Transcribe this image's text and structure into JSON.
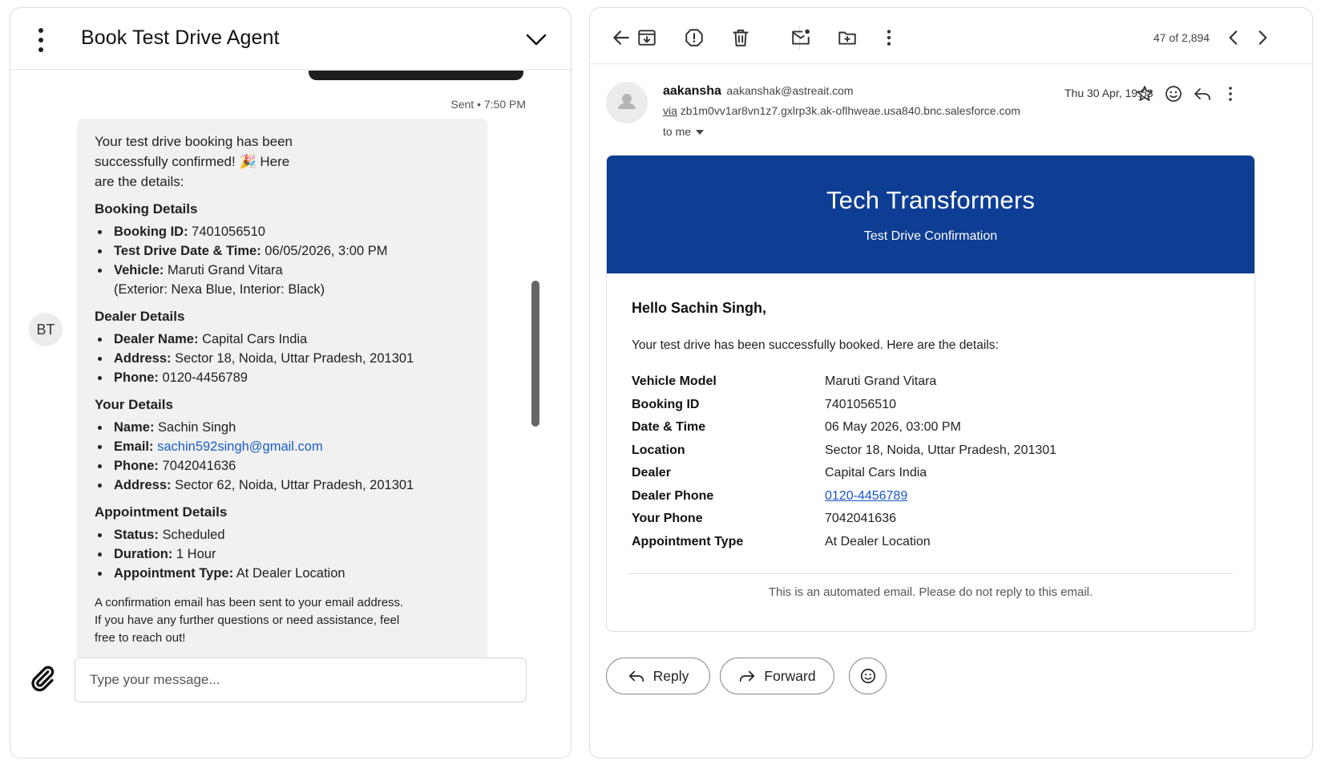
{
  "chat": {
    "title": "Book Test Drive Agent",
    "sent_meta": "Sent • 7:50 PM",
    "avatar_initials": "BT",
    "intro_line1": "Your test drive booking has been",
    "intro_line2": "successfully confirmed! 🎉 Here",
    "intro_line3": "are the details:",
    "booking": {
      "heading": "Booking Details",
      "id_label": "Booking ID:",
      "id_value": "7401056510",
      "date_label": "Test Drive Date & Time:",
      "date_value": "06/05/2026, 3:00 PM",
      "vehicle_label": "Vehicle:",
      "vehicle_value": "Maruti Grand Vitara",
      "vehicle_colors": "(Exterior: Nexa Blue, Interior: Black)"
    },
    "dealer": {
      "heading": "Dealer Details",
      "name_label": "Dealer Name:",
      "name_value": "Capital Cars India",
      "address_label": "Address:",
      "address_value": "Sector 18, Noida, Uttar Pradesh, 201301",
      "phone_label": "Phone:",
      "phone_value": "0120-4456789"
    },
    "user": {
      "heading": "Your Details",
      "name_label": "Name:",
      "name_value": "Sachin Singh",
      "email_label": "Email:",
      "email_value": "sachin592singh@gmail.com",
      "phone_label": "Phone:",
      "phone_value": "7042041636",
      "address_label": "Address:",
      "address_value": "Sector 62, Noida, Uttar Pradesh, 201301"
    },
    "appointment": {
      "heading": "Appointment Details",
      "status_label": "Status:",
      "status_value": "Scheduled",
      "duration_label": "Duration:",
      "duration_value": "1 Hour",
      "type_label": "Appointment Type:",
      "type_value": "At Dealer Location"
    },
    "closing": "A confirmation email has been sent to your email address. If you have any further questions or need assistance, feel free to reach out!",
    "input_placeholder": "Type your message..."
  },
  "mail": {
    "pager": "47 of 2,894",
    "sender_name": "aakansha",
    "sender_email": "aakanshak@astreait.com",
    "via_label": "via",
    "via_domain": "zb1m0vv1ar8vn1z7.gxlrp3k.ak-oflhweae.usa840.bnc.salesforce.com",
    "to_label": "to me",
    "date": "Thu 30 Apr, 19:53",
    "banner_title": "Tech Transformers",
    "banner_subtitle": "Test Drive Confirmation",
    "greeting": "Hello Sachin Singh,",
    "intro": "Your test drive has been successfully booked. Here are the details:",
    "details": [
      {
        "label": "Vehicle Model",
        "value": "Maruti Grand Vitara"
      },
      {
        "label": "Booking ID",
        "value": "7401056510"
      },
      {
        "label": "Date & Time",
        "value": "06 May 2026, 03:00 PM"
      },
      {
        "label": "Location",
        "value": "Sector 18, Noida, Uttar Pradesh, 201301"
      },
      {
        "label": "Dealer",
        "value": "Capital Cars India"
      },
      {
        "label": "Dealer Phone",
        "value": "0120-4456789"
      },
      {
        "label": "Your Phone",
        "value": "7042041636"
      },
      {
        "label": "Appointment Type",
        "value": "At Dealer Location"
      }
    ],
    "footer_note": "This is an automated email. Please do not reply to this email.",
    "reply_label": "Reply",
    "forward_label": "Forward",
    "banner_color": "#0e3e94",
    "link_color": "#1a57c7"
  }
}
